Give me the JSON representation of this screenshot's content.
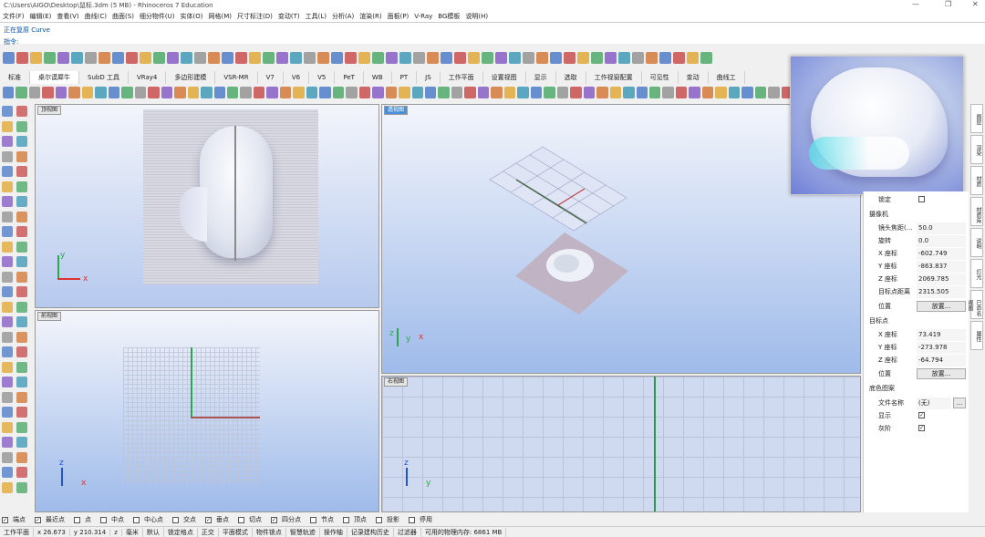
{
  "window": {
    "title": "C:\\Users\\AIGO\\Desktop\\鼠标.3dm (5 MB) - Rhinoceros 7 Education"
  },
  "menu": [
    "文件(F)",
    "编辑(E)",
    "查看(V)",
    "曲线(C)",
    "曲面(S)",
    "细分物件(U)",
    "实体(O)",
    "网格(M)",
    "尺寸标注(D)",
    "变动(T)",
    "工具(L)",
    "分析(A)",
    "渲染(R)",
    "面板(P)",
    "V-Ray",
    "BG模板",
    "说明(H)"
  ],
  "command": {
    "history": "正在复原 Curve",
    "prompt": "指令:"
  },
  "tabs": [
    "标准",
    "桌尔谟犀牛",
    "SubD 工具",
    "VRay4",
    "多边形建模",
    "VSR-MR",
    "V7",
    "V6",
    "V5",
    "PeT",
    "WB",
    "PT",
    "JS",
    "工作平面",
    "设置视图",
    "显示",
    "选取",
    "工作视窗配置",
    "可见性",
    "变动",
    "曲线工"
  ],
  "active_tab_index": 1,
  "viewports": {
    "top": {
      "label": "顶视图",
      "axis_y": "y",
      "axis_x": "x"
    },
    "perspective": {
      "label": "透视图",
      "axis_z": "z",
      "axis_y": "y",
      "axis_x": "x"
    },
    "front": {
      "label": "前视图",
      "axis_z": "z",
      "axis_x": "x"
    },
    "right": {
      "label": "右视图",
      "axis_z": "z",
      "axis_y": "y"
    }
  },
  "properties": {
    "lock_label": "锁定",
    "camera_header": "摄像机",
    "rows": [
      {
        "k": "镜头焦距(...",
        "v": "50.0"
      },
      {
        "k": "旋转",
        "v": "0.0"
      },
      {
        "k": "X 座标",
        "v": "-602.749"
      },
      {
        "k": "Y 座标",
        "v": "-863.837"
      },
      {
        "k": "Z 座标",
        "v": "2069.785"
      },
      {
        "k": "目标点距离",
        "v": "2315.505"
      }
    ],
    "position_label": "位置",
    "place_button": "放置...",
    "target_header": "目标点",
    "target_rows": [
      {
        "k": "X 座标",
        "v": "73.419"
      },
      {
        "k": "Y 座标",
        "v": "-273.978"
      },
      {
        "k": "Z 座标",
        "v": "-64.794"
      }
    ],
    "target_position_label": "位置",
    "target_place_button": "放置...",
    "bg_header": "底色图案",
    "filename_label": "文件名称",
    "filename_value": "(无)",
    "browse_button": "...",
    "show_label": "显示",
    "gray_label": "灰阶"
  },
  "side_tabs": [
    "图层",
    "渲染",
    "材质",
    "材质库",
    "说明",
    "灯光",
    "已命名视图",
    "属性"
  ],
  "osnap": [
    {
      "label": "端点",
      "checked": true
    },
    {
      "label": "最近点",
      "checked": true
    },
    {
      "label": "点",
      "checked": false
    },
    {
      "label": "中点",
      "checked": false
    },
    {
      "label": "中心点",
      "checked": false
    },
    {
      "label": "交点",
      "checked": false
    },
    {
      "label": "垂点",
      "checked": true
    },
    {
      "label": "切点",
      "checked": false
    },
    {
      "label": "四分点",
      "checked": true
    },
    {
      "label": "节点",
      "checked": false
    },
    {
      "label": "顶点",
      "checked": false
    },
    {
      "label": "投影",
      "checked": false
    },
    {
      "label": "停用",
      "checked": false
    }
  ],
  "status": {
    "cplane": "工作平面",
    "x": "x 26.673",
    "y": "y 210.314",
    "z": "z",
    "unit": "毫米",
    "layer": "默认",
    "items": [
      "锁定格点",
      "正交",
      "平面模式",
      "物件锁点",
      "智慧轨迹",
      "操作轴",
      "记录建构历史",
      "过滤器",
      "可用的物理内存: 6861 MB"
    ]
  },
  "colors": {
    "viewport_top": "#f2f4fb",
    "viewport_bottom": "#8fb0e6",
    "active_label": "#4a90d9",
    "grid": "#b8bccb"
  }
}
